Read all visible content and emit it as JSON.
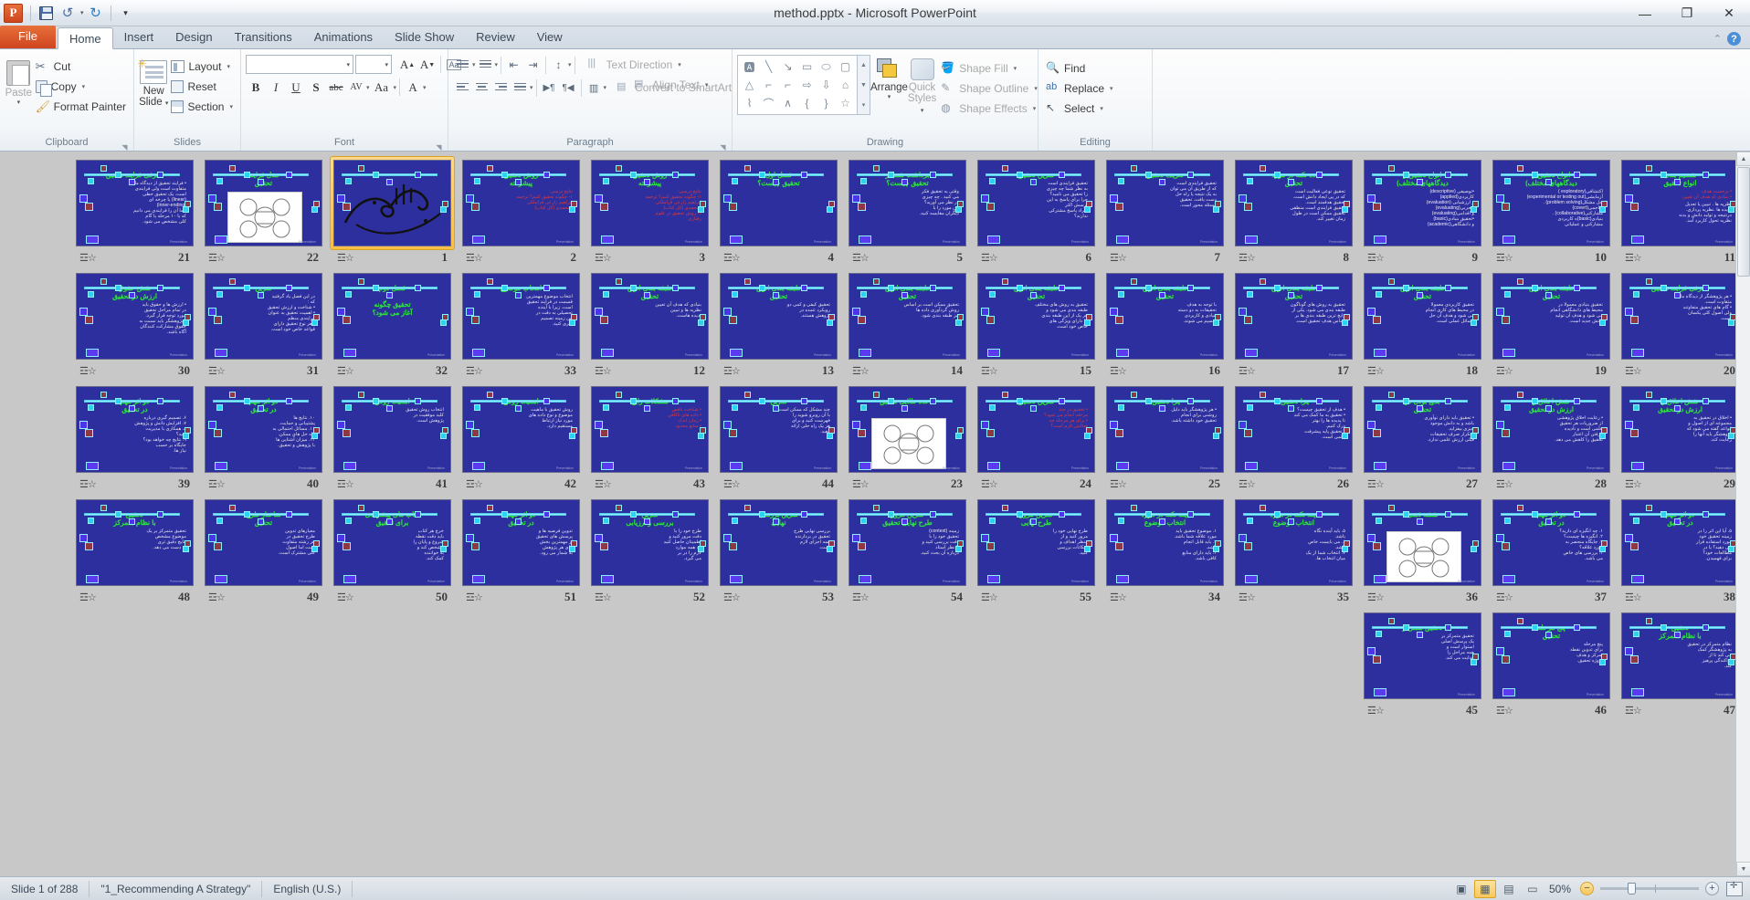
{
  "window": {
    "title": "method.pptx  -  Microsoft PowerPoint",
    "app_logo": "P",
    "minimize": "—",
    "restore": "❐",
    "close": "✕"
  },
  "quick_access": {
    "save": "save-icon",
    "undo": "↺",
    "undo_caret": "▾",
    "redo": "↻",
    "customize": "▾"
  },
  "tabs": [
    {
      "label": "File",
      "active": false,
      "file": true
    },
    {
      "label": "Home",
      "active": true
    },
    {
      "label": "Insert",
      "active": false
    },
    {
      "label": "Design",
      "active": false
    },
    {
      "label": "Transitions",
      "active": false
    },
    {
      "label": "Animations",
      "active": false
    },
    {
      "label": "Slide Show",
      "active": false
    },
    {
      "label": "Review",
      "active": false
    },
    {
      "label": "View",
      "active": false
    }
  ],
  "ribbon": {
    "collapse_icon": "⌃",
    "help_icon": "?",
    "groups": {
      "clipboard": {
        "label": "Clipboard",
        "paste": "Paste",
        "paste_caret": "▾",
        "cut": "Cut",
        "copy": "Copy",
        "copy_caret": "▾",
        "format_painter": "Format Painter",
        "launcher": "◥"
      },
      "slides": {
        "label": "Slides",
        "new_slide_line1": "New",
        "new_slide_line2": "Slide",
        "new_slide_caret": "▾",
        "layout": "Layout",
        "layout_caret": "▾",
        "reset": "Reset",
        "section": "Section",
        "section_caret": "▾"
      },
      "font": {
        "label": "Font",
        "font_name": "",
        "font_size": "",
        "grow": "A",
        "shrink": "A",
        "clear_formatting": "Aa",
        "bold": "B",
        "italic": "I",
        "underline": "U",
        "shadow": "S",
        "strikethrough": "abc",
        "spacing": "AV",
        "change_case": "Aa",
        "font_color": "A",
        "launcher": "◥"
      },
      "paragraph": {
        "label": "Paragraph",
        "bullets": "bullets-icon",
        "numbering": "numbering-icon",
        "decrease_indent": "decrease-indent-icon",
        "increase_indent": "increase-indent-icon",
        "line_spacing": "line-spacing-icon",
        "align_left": "align-left-icon",
        "align_center": "align-center-icon",
        "align_right": "align-right-icon",
        "justify": "justify-icon",
        "ltr": "▶¶",
        "rtl": "¶◀",
        "columns": "columns-icon",
        "text_direction": "Text Direction",
        "align_text": "Align Text",
        "convert_smartart": "Convert to SmartArt",
        "launcher": "◥"
      },
      "drawing": {
        "label": "Drawing",
        "shapes": [
          "A",
          "╲",
          "↘",
          "▭",
          "◯",
          "▢",
          "△",
          "⌐",
          "⌐",
          "⇨",
          "⇩",
          "⌂",
          "⌇",
          "⌒",
          "∧",
          "{",
          "}",
          "☆"
        ],
        "scroll_up": "▲",
        "scroll_down": "▼",
        "scroll_more": "▾",
        "arrange": "Arrange",
        "arrange_caret": "▾",
        "quick_styles_line1": "Quick",
        "quick_styles_line2": "Styles",
        "quick_styles_caret": "▾",
        "shape_fill": "Shape Fill",
        "shape_outline": "Shape Outline",
        "shape_effects": "Shape Effects",
        "caret": "▾"
      },
      "editing": {
        "label": "Editing",
        "find": "Find",
        "replace": "Replace",
        "select": "Select",
        "caret": "▾"
      }
    }
  },
  "status_bar": {
    "slide_counter": "Slide 1 of 288",
    "theme": "\"1_Recommending A Strategy\"",
    "language": "English (U.S.)",
    "zoom_level": "50%",
    "zoom_out": "−",
    "zoom_in": "+",
    "views": [
      {
        "name": "normal",
        "glyph": "▣",
        "active": false
      },
      {
        "name": "slide-sorter",
        "glyph": "▦",
        "active": true
      },
      {
        "name": "reading",
        "glyph": "▤",
        "active": false
      },
      {
        "name": "slide-show",
        "glyph": "▭",
        "active": false
      }
    ],
    "fit_to_window": "fit-slide-icon"
  },
  "sorter": {
    "scroll_up": "▲",
    "scroll_down": "▼",
    "transition_icon": "transition-star-icon",
    "slides": [
      {
        "num": "11",
        "title": "تقسیم بندی\nانواع تحقیق",
        "body_red": "• برحسب هدف\n• بنیادی که هدف آن تعیین",
        "body_white": "نظریه ها . تبیین یا تعدیل\nپدیده ها .نظریه پردازی.\nدرنتیجه و تولید دانش و بدنه\nنظریه تحول کاربرد آمد.",
        "foot": "Presentation"
      },
      {
        "num": "10",
        "title": "انواع تحقیق(ر\nدیدگاههای مختلف)",
        "body_white": "اکتشافی(exploratory )\nآزمایشی(experimental or testing out)\nحل مشکل(problem solving) .\nتهاجمی(covert)\nمشارکتی(collaborative) .\nبنیادی(basic)ه کاربردی\nمشارکتی و عملیاتی",
        "foot": "Presentation"
      },
      {
        "num": "9",
        "title": "انواع تحقیق(ر\nدیدگاههای مختلف)",
        "body_white": "•توصیفی (descriptive)\nکاربردی(applied)\nو ارزشیابی (evaluation)\n•تجربی(evaluating)\nو اقدامی(evaluating)\n•تحقیق بنیادی(basic)\nو دانشگاهی(academic)",
        "foot": "Presentation"
      },
      {
        "num": "8",
        "title": "ده نکته در مورد\nتحقیق",
        "body_white": "تحقیق نوعی فعالیت است\nکه در پی ایجاد دانش است.\nتحقیق هدفمند است.\nتحقیق فرایندی است منطقی\nتحقیق ممکن است در طول\nزمان تغییر کند.",
        "foot": "Presentation"
      },
      {
        "num": "7",
        "title": "تعریف تحقیق",
        "body_white": "تحقیق فرایندی است\nکه از طریق آن می توان\nبه یک نتیجه یا راه حل\nدست یافت. تحقیق\nمسئله محور است.",
        "foot": "Presentation"
      },
      {
        "num": "6",
        "title": "تمرین تحقیق",
        "body_white": "تحقیق فرایندی است\nبه نظر شما چه چیزی\nرا تحقیق می نامید؟\nچرا برای پاسخ به این\nپرسش اکثر\nافراد پاسخ مشترکی\nندارند؟",
        "foot": "Presentation"
      },
      {
        "num": "5",
        "title": "برداشت شما از\nتحقیق چیست؟",
        "body_white": "وقتی به تحقیق فکر\nمی کنید . چه چیزی\nدر نظر می آورید؟\nاین مورد را با\nدیگران مقایسه کنید.",
        "foot": "Presentation"
      },
      {
        "num": "4",
        "title": "فصل اول\nتحقیق چیست؟",
        "body_white": "",
        "foot": "Presentation"
      },
      {
        "num": "3",
        "title": "روش تحقیق\nپیشرفته",
        "body_red": "نتایج درسی:\n۱- چگونه تحقیق کنیم؟ ترجمه\nابراهیم زارعی قراملکی\nومحمدی  (کل کتاب)\n۲- روش تحقیق در علوم\nرفتاری",
        "foot": "Presentation"
      },
      {
        "num": "2",
        "title": "روش تحقیق\nپیشرفته",
        "body_red": "نتایج درسی:\n۱- چگونه تحقیق کنیم؟ ترجمه\nابراهیم زارعی قراملکی\nومحمدی  (کل کتاب)",
        "foot": "Presentation"
      },
      {
        "num": "1",
        "title": "",
        "body_white": "",
        "selected": true,
        "art": "bismillah-calligraphy"
      },
      {
        "num": "22",
        "title": "مدل فرایند\nتحقیق",
        "body_white": "",
        "image": true,
        "foot": "Presentation"
      },
      {
        "num": "21",
        "title": "معرفی فرایند تحقیق",
        "body_white": "• فرایند تحقیق از دیدگاه ما\nمتفاوت است ولی فرایندی\nاست. یک تحقیق خطی\n(linear) یا چرخه ای\n(inner-ending)\n• ما آن را فرایندی می دانیم\nکه با ۱۰ مرحله یا گام\nکلی مشخص می شود.",
        "foot": "Presentation"
      },
      {
        "num": "20",
        "title": "معرفی فرایند تحقیق",
        "body_white": "• هر پژوهشگر از دیدگاه ما\nمتفاوت است.\n• گام های تحقیق متفاوتند\nولی اصول کلی یکسان\nاست.",
        "foot": "Presentation"
      },
      {
        "num": "19",
        "title": "طبقه بندی انواع\nتحقیق",
        "body_white": "تحقیق بنیادی معمولا در\nمحیط های دانشگاهی انجام\nمی شود و هدف آن تولید\nدانش جدید است.",
        "foot": "Presentation"
      },
      {
        "num": "18",
        "title": "طبقه بندی انواع\nتحقیق",
        "body_white": "تحقیق کاربردی معمولا\nدر محیط های کاری انجام\nمی شود و هدف آن حل\nمسائل عملی است.",
        "foot": "Presentation"
      },
      {
        "num": "17",
        "title": "طبقه بندی انواع\nتحقیق",
        "body_white": "تحقیق به روش های گوناگون\nطبقه بندی می شود. یکی از\nرایج ترین طبقه بندی ها بر\nاساس هدف تحقیق است.",
        "foot": "Presentation"
      },
      {
        "num": "16",
        "title": "طبقه بندی انواع\nتحقیق",
        "body_white": "با توجه به هدف\nتحقیقات به دو دسته\nبنیادی و کاربردی\nتقسیم می شوند.",
        "foot": "Presentation"
      },
      {
        "num": "15",
        "title": "طبقه بندی انواع\nتحقیق",
        "body_white": "تحقیق به روش های مختلف\nطبقه بندی می شود و\nهر یک از این طبقه بندی\nها دارای ویژگی های\nخاص خود است.",
        "foot": "Presentation"
      },
      {
        "num": "14",
        "title": "طبقه بندی انواع\nتحقیق",
        "body_white": "تحقیق ممکن است بر اساس\nروش گردآوری داده ها\nنیز طبقه بندی شود.",
        "foot": "Presentation"
      },
      {
        "num": "13",
        "title": "طبقه بندی انواع\nتحقیق",
        "body_white": "تحقیق کیفی و کمی دو\nرویکرد عمده در\nپژوهش هستند.",
        "foot": "Presentation"
      },
      {
        "num": "12",
        "title": "طبقه بندی انواع\nتحقیق",
        "body_white": "بنیادی که هدف آن تعیین\nنظریه ها و تبیین\nپدیده هاست.",
        "foot": "Presentation"
      },
      {
        "num": "33",
        "title": "انتخاب موضوع",
        "body_white": "انتخاب موضوع مهمترین\nقسمت در فرایند تحقیق\nاست. زیرا با آینده\nتحصیلی به دقت در\nاین زمینه تصمیم\nگیری کنید.",
        "foot": "Presentation"
      },
      {
        "num": "32",
        "title": "فصل دوم\n\nتحقیق چگونه\nآغاز می شود؟",
        "body_red": "",
        "foot": "Presentation"
      },
      {
        "num": "31",
        "title": "تمرین",
        "body_white": "در این فصل یاد گرفتید\nکه :\n• شناخت و ارزش تحقیق\n• اهمیت تحقیق به عنوان\nفرایندی منظم\n• هر نوع تحقیق دارای\nقواعد خاص خود است.",
        "foot": "Presentation"
      },
      {
        "num": "30",
        "title": "نقش حقوق\nارزش در تحقیق",
        "body_white": "• ارزش ها و حقوق باید\nدر تمام مراحل تحقیق\nمورد توجه قرار گیرد.\n• پژوهشگر باید نسبت به\nحقوق مشارکت کنندگان\nآگاه باشد.",
        "foot": "Presentation"
      },
      {
        "num": "29",
        "title": "نقش اخلاق و\nارزش در تحقیق",
        "body_white": "• اخلاق در تحقیق به\nمجموعه ای از اصول و\nقواعد گفته می شود که\nپژوهشگر باید آنها را\nرعایت کند.",
        "foot": "Presentation"
      },
      {
        "num": "28",
        "title": "نقش اخلاق و\nارزش در تحقیق",
        "body_white": "• رعایت اخلاق پژوهشی\nاز ضروریات هر تحقیق\nعلمی است و نادیده\nگرفتن آن اعتبار\nتحقیق را کاهش می دهد.",
        "foot": "Presentation"
      },
      {
        "num": "27",
        "title": "بدیع بودن در\nتحقیق",
        "body_white": "• تحقیق باید دارای نوآوری\nباشد و به دانش موجود\nچیزی بیفزاید.\n• تکرار صرف تحقیقات\nقبلی ارزش علمی ندارد.",
        "foot": "Presentation"
      },
      {
        "num": "26",
        "title": "چرا تحقیق؟",
        "body_white": "• هدف از تحقیق چیست؟\n• تحقیق به ما کمک می کند\nتا پدیده ها را بهتر\nدرک کنیم.\n• تحقیق پایه پیشرفت\nعلمی است.",
        "foot": "Presentation"
      },
      {
        "num": "25",
        "title": "چرا تحقیق؟",
        "body_white": "• هر پژوهشگر باید دلیل\nروشنی برای انجام\nتحقیق خود داشته باشد.",
        "foot": "Presentation"
      },
      {
        "num": "24",
        "title": "تمرین تحقیق",
        "body_red": "• تحقیق در چند\nمرحله انجام می شود؟\n• برای هر مرحله چه\nفعالیتی لازم است؟",
        "foot": "Presentation"
      },
      {
        "num": "23",
        "title": "قاعده طلایی تحقیق",
        "body_white": "",
        "image": true,
        "foot": "Presentation"
      },
      {
        "num": "44",
        "title": "تمرین",
        "body_white": "چند مشکل که ممکن است\nبا آن روبرو شوید را\nفهرست کنید و برای\nهر یک راه حلی ارائه\nدهید.",
        "foot": "Presentation"
      },
      {
        "num": "43",
        "title": "مشکلات رایج",
        "body_red": "• شناخت ناقص\n• داده های ناکافی\n• زمان اندک\n• منابع محدود",
        "foot": "Presentation"
      },
      {
        "num": "42",
        "title": "اهمیت روش",
        "body_white": "روش تحقیق با ماهیت\nموضوع و نوع داده های\nمورد نیاز ارتباط\nمستقیم دارد.",
        "foot": "Presentation"
      },
      {
        "num": "41",
        "title": "اهمیت روش",
        "body_white": "انتخاب روش تحقیق\nکلید موفقیت در\nپژوهش است.",
        "foot": "Presentation"
      },
      {
        "num": "40",
        "title": "دو اثر مهم\nدر تحقیق",
        "body_white": "۱۰. نتایج ها\nپشتیبانی و حمایت.\n۱۱. مسائل احتمالی به\nراه حل های ممکن.\n۱۲. میزان آشنایی ها\nبا پژوهش و تحقیق.",
        "foot": "Presentation"
      },
      {
        "num": "39",
        "title": "دو اثر مهم\nدر تحقیق",
        "body_white": "۶. تصمیم گیری درباره\n۷. افزایش دانش و پژوهش\n۸. همکاری با مدیریت\nکنید؟\n۹. نتایج چه خواهد بود؟\nجایگاه بر حسب\nنیاز ها.",
        "foot": "Presentation"
      },
      {
        "num": "38",
        "title": "دو اثر مهم\nدر تحقیق",
        "body_white": "۵. آیا این اثر را در\nزمینه تحقیق خود\nمورد استفاده قرار\nمی دهید؟ یا در\nمطالعات خود؟\nبرای فهمیدن.",
        "foot": "Presentation"
      },
      {
        "num": "37",
        "title": "دو اثر مهم\nدر تحقیق",
        "body_white": "۱. چه انگیزه ای دارید؟\n۲. انگیزه ها چیست؟\n۳. جایگاه منحصر به\nمورد علاقه؟\n۴. بررسی های خاص\nمی باشد.",
        "foot": "Presentation"
      },
      {
        "num": "36",
        "title": "نقشه ذهنی",
        "body_white": "",
        "image": true,
        "foot": "Presentation"
      },
      {
        "num": "35",
        "title": "چند نکته در مورد\nانتخاب موضوع",
        "body_white": "۵. باید آینده نگاه\nباشد.\n۶. می بایست خاص\nباشد.\n۷. انتخاب شما از یک\nمیان انتخاب ها.",
        "foot": "Presentation"
      },
      {
        "num": "34",
        "title": "چند نکته در مورد\nانتخاب موضوع",
        "body_white": "۱. موضوع تحقیق باید\nمورد علاقه شما باشد.\n۲. باید قابل انجام\nباشد.\n۳. باید دارای منابع\nکافی باشد.",
        "foot": "Presentation"
      },
      {
        "num": "55",
        "title": "تمرین مرور\nطرح نهایی",
        "body_white": "طرح نهایی خود را\nمرور کنید و از\nمنظر اهداف و\nامکانات بررسی\nکنید.",
        "foot": "Presentation"
      },
      {
        "num": "54",
        "title": "تمرین مرور\nطرح نهایی تحقیق",
        "body_white": "زمینه (context)\nتحقیق خود را با\nدقت بررسی کنید و\nبا نظر استاد\nدرباره آن بحث کنید.",
        "foot": "Presentation"
      },
      {
        "num": "53",
        "title": "تمرین بررسی\nنهایی",
        "body_white": "بررسی نهایی طرح\nتحقیق در بردارنده\nهمه اجزای لازم\nاست.",
        "foot": "Presentation"
      },
      {
        "num": "52",
        "title": "تمرین\nبررسی و ارزیابی",
        "body_white": "طرح خود را با\nدقت مرور کنید و\nاطمینان حاصل کنید\nکه همه موارد\nلازم را در بر\nمی گیرد.",
        "foot": "Presentation"
      },
      {
        "num": "51",
        "title": "دو اثر مهم\nدر تحقیق",
        "body_white": "تدوین فرضیه ها و\nپرسش های تحقیق\nاز مهمترین بخش\nهای هر پژوهش\nبه شمار می رود.",
        "foot": "Presentation"
      },
      {
        "num": "50",
        "title": "کتاب های پیشنهادی\nبرای تحقیق",
        "body_white": "خرج هر کتاب\nباید دقت نقطه\nشروع و پایان را\nمشخص کند و\nبه خواننده\nکمک کند.",
        "foot": "Presentation"
      },
      {
        "num": "49",
        "title": "ساختار طرح\nتحقیق",
        "body_white": "معیارهای تدوین\nطرح تحقیق در\nهر رشته متفاوت\nاست اما اصول\nکلی مشترک است.",
        "foot": "Presentation"
      },
      {
        "num": "48",
        "title": "تحقیق\nبا نظام متمرکز",
        "body_white": "تحقیق متمرکز بر یک\nموضوع مشخص\nنتایج دقیق تری\nبه دست می دهد.",
        "foot": "Presentation"
      },
      {
        "num": "47",
        "title": "تحقیق\nبا نظام متمرکز",
        "body_white": "نظام متمرکز در تحقیق\nبه پژوهشگر کمک\nمی کند تا از\nپراکندگی پرهیز\nکند.",
        "foot": "Presentation"
      },
      {
        "num": "46",
        "title": "پنج مرحله\nتحقیق",
        "body_white": "پنج مرحله\nبرای تدوین نقطه\nتمرکز و هدف\nپروژه تحقیق.",
        "foot": "Presentation"
      },
      {
        "num": "45",
        "title": "تحقیق متمرکز",
        "body_white": "تحقیق متمرکز بر\nیک پرسش اصلی\nاستوار است و\nهمه مراحل را\nهدایت می کند.",
        "foot": "Presentation"
      }
    ]
  }
}
